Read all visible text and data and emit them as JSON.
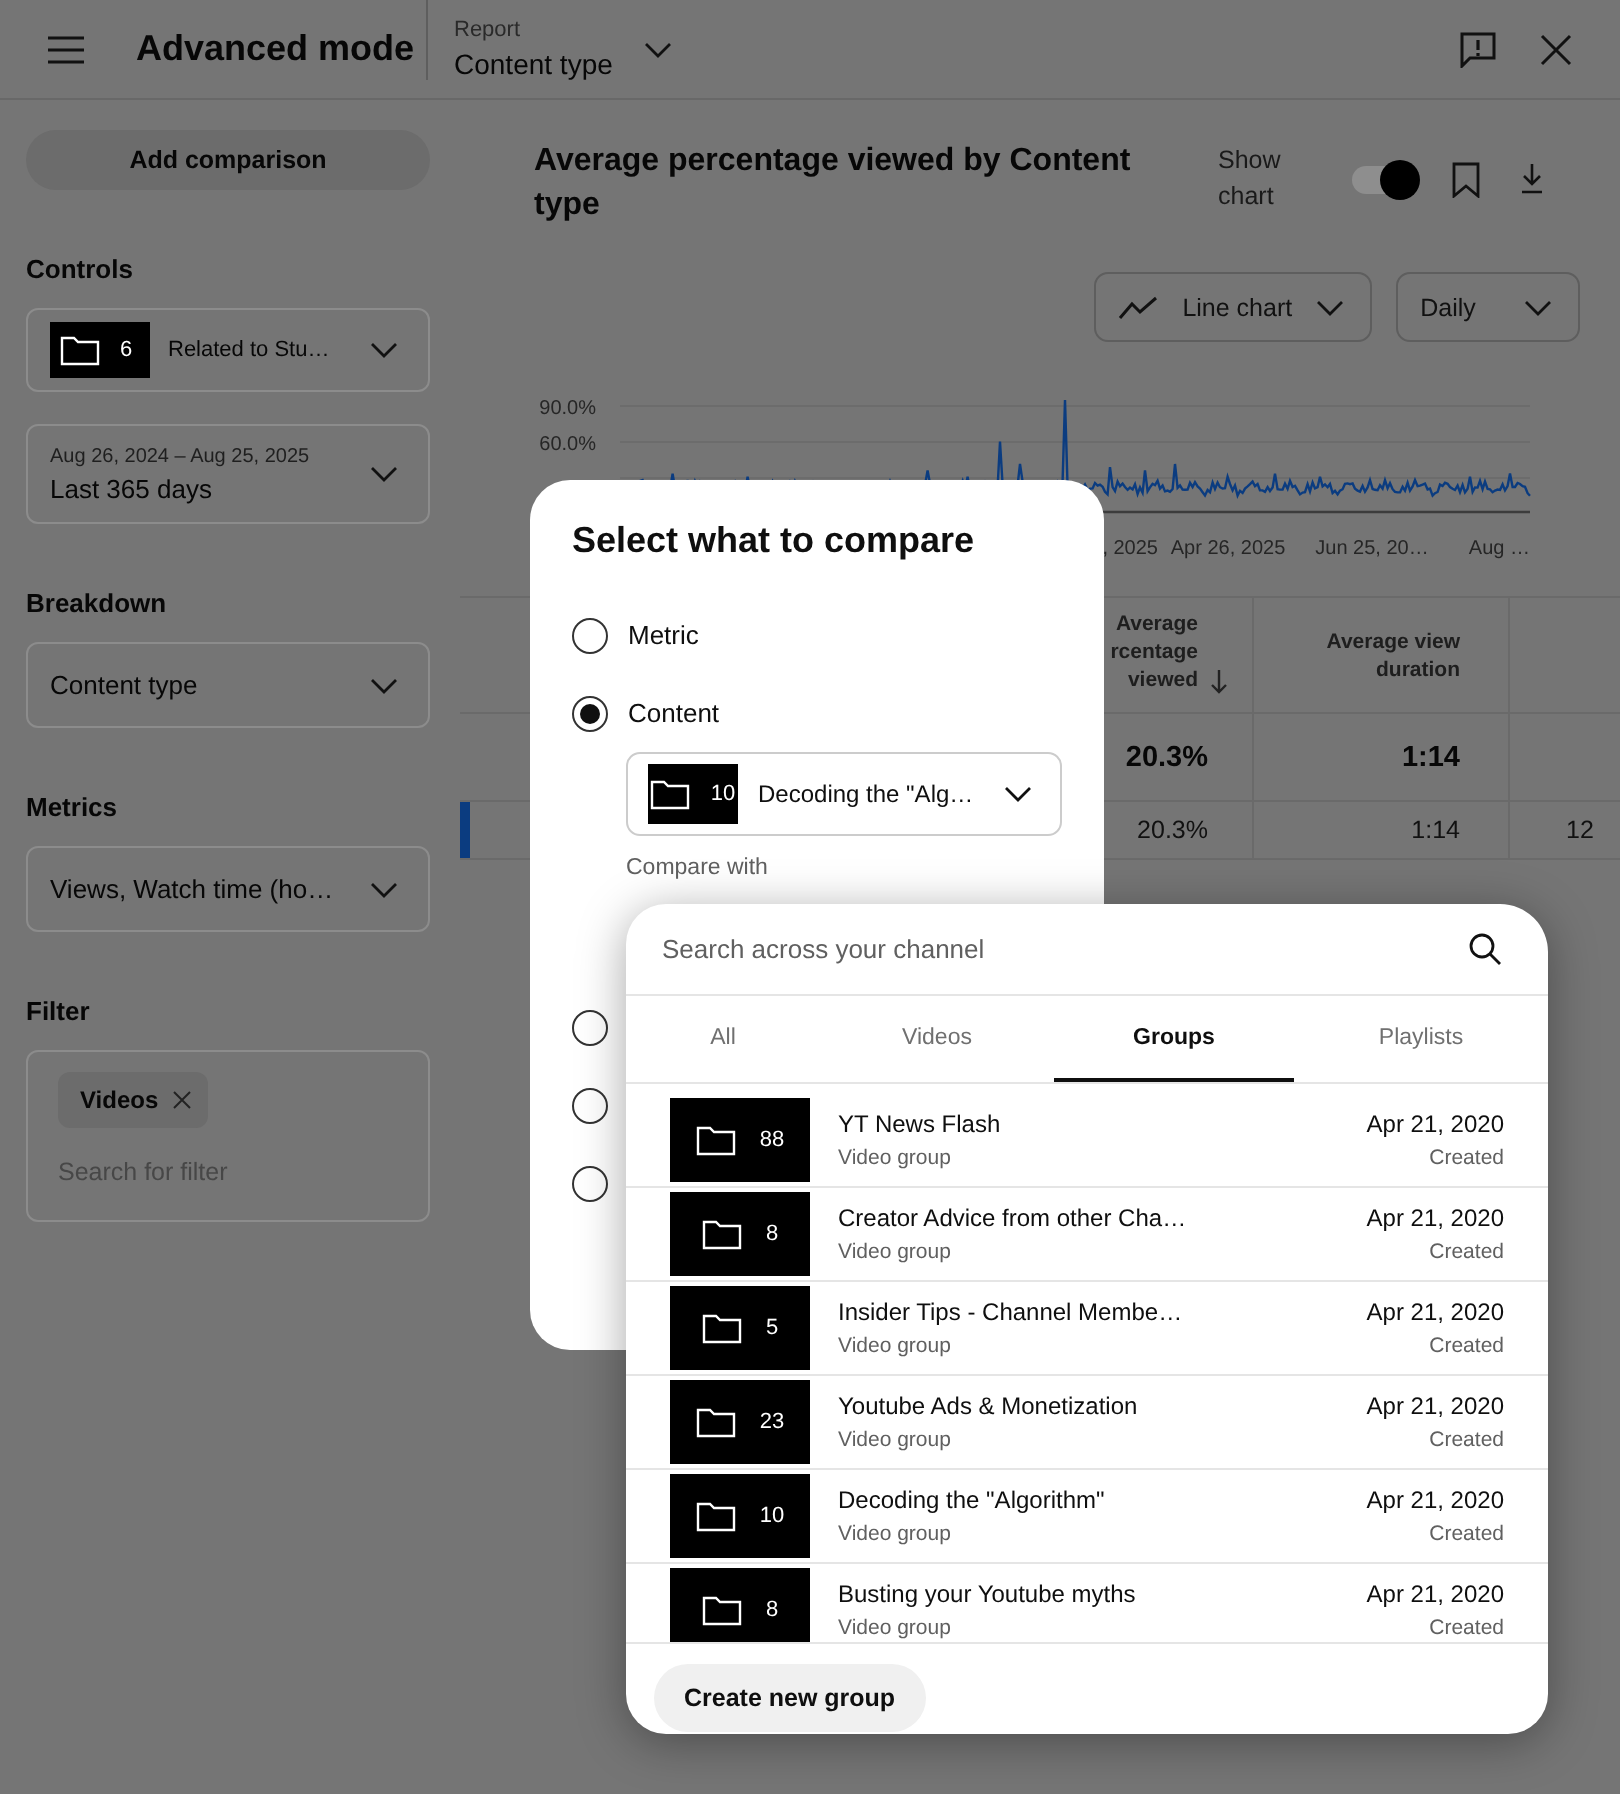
{
  "header": {
    "title": "Advanced mode",
    "report_label": "Report",
    "report_value": "Content type"
  },
  "sidebar": {
    "add_button": "Add comparison",
    "sections": [
      {
        "heading": "Controls",
        "fields": [
          {
            "kind": "group",
            "count": "6",
            "value": "Related to Stu…"
          },
          {
            "kind": "date",
            "range": "Aug 26, 2024 – Aug 25, 2025",
            "value": "Last 365 days"
          }
        ]
      },
      {
        "heading": "Breakdown",
        "fields": [
          {
            "kind": "select",
            "value": "Content type"
          }
        ]
      },
      {
        "heading": "Metrics",
        "fields": [
          {
            "kind": "select",
            "value": "Views, Watch time (ho…"
          }
        ]
      },
      {
        "heading": "Filter",
        "fields": [
          {
            "kind": "filter",
            "chips": [
              "Videos"
            ],
            "placeholder": "Search for filter"
          }
        ]
      }
    ]
  },
  "report": {
    "title": "Average percentage viewed by Content type",
    "show_chart_label": "Show chart",
    "show_chart": true,
    "chart_type": "Line chart",
    "interval": "Daily",
    "chart": {
      "y_labels": [
        "90.0%",
        "60.0%"
      ],
      "x_labels": [
        ", 2025",
        "Apr 26, 2025",
        "Jun 25, 20…",
        "Aug …"
      ]
    },
    "table": {
      "columns": [
        {
          "lines": [
            "Average",
            "rcentage",
            "viewed"
          ],
          "sorted": true
        },
        {
          "lines": [
            "Average view",
            "duration"
          ],
          "sorted": false
        }
      ],
      "total": [
        "20.3%",
        "1:14"
      ],
      "rows": [
        {
          "color": "#0b3c80",
          "values": [
            "20.3%",
            "1:14",
            "12"
          ]
        }
      ]
    }
  },
  "compare_dialog": {
    "title": "Select what to compare",
    "options": [
      {
        "label": "Metric",
        "selected": false
      },
      {
        "label": "Content",
        "selected": true,
        "select": {
          "count": "10",
          "value": "Decoding the \"Alg…"
        },
        "compare_label": "Compare with"
      },
      {
        "selected": false
      },
      {
        "selected": false
      },
      {
        "selected": false
      }
    ]
  },
  "group_picker": {
    "placeholder": "Search across your channel",
    "tabs": [
      {
        "label": "All",
        "selected": false
      },
      {
        "label": "Videos",
        "selected": false
      },
      {
        "label": "Groups",
        "selected": true
      },
      {
        "label": "Playlists",
        "selected": false
      }
    ],
    "items": [
      {
        "count": "88",
        "title": "YT News Flash",
        "subtitle": "Video group",
        "date": "Apr 21, 2020",
        "date_label": "Created"
      },
      {
        "count": "8",
        "title": "Creator Advice from other Cha…",
        "subtitle": "Video group",
        "date": "Apr 21, 2020",
        "date_label": "Created"
      },
      {
        "count": "5",
        "title": "Insider Tips - Channel Membe…",
        "subtitle": "Video group",
        "date": "Apr 21, 2020",
        "date_label": "Created"
      },
      {
        "count": "23",
        "title": "Youtube Ads & Monetization",
        "subtitle": "Video group",
        "date": "Apr 21, 2020",
        "date_label": "Created"
      },
      {
        "count": "10",
        "title": "Decoding the \"Algorithm\"",
        "subtitle": "Video group",
        "date": "Apr 21, 2020",
        "date_label": "Created"
      },
      {
        "count": "8",
        "title": "Busting your Youtube myths",
        "subtitle": "Video group",
        "date": "Apr 21, 2020",
        "date_label": "Created"
      }
    ],
    "create_button": "Create new group"
  }
}
